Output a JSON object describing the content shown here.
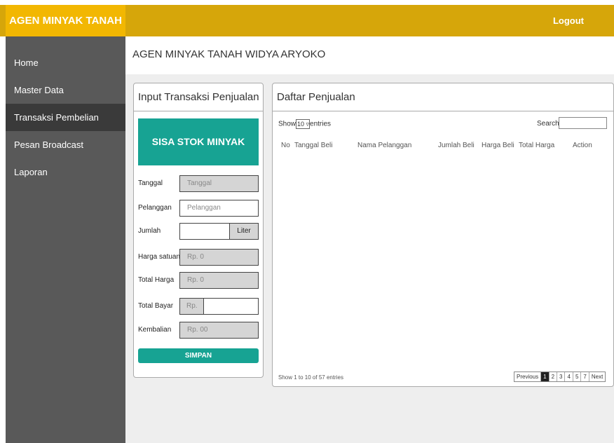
{
  "header": {
    "brand": "AGEN MINYAK TANAH",
    "logout_label": "Logout"
  },
  "sidebar": {
    "items": [
      {
        "label": "Home"
      },
      {
        "label": "Master Data"
      },
      {
        "label": "Transaksi Pembelian"
      },
      {
        "label": "Pesan Broadcast"
      },
      {
        "label": "Laporan"
      }
    ]
  },
  "main": {
    "page_title": "AGEN MINYAK TANAH WIDYA ARYOKO"
  },
  "form_panel": {
    "title": "Input Transaksi Penjualan",
    "stock_label": "SISA STOK MINYAK",
    "fields": {
      "tanggal": {
        "label": "Tanggal",
        "placeholder": "Tanggal"
      },
      "pelanggan": {
        "label": "Pelanggan",
        "placeholder": "Pelanggan"
      },
      "jumlah": {
        "label": "Jumlah",
        "unit": "Liter"
      },
      "harga_satuan": {
        "label": "Harga satuan",
        "value": "Rp. 0"
      },
      "total_harga": {
        "label": "Total Harga",
        "value": "Rp. 0"
      },
      "total_bayar": {
        "label": "Total Bayar",
        "prefix": "Rp."
      },
      "kembalian": {
        "label": "Kembalian",
        "value": "Rp. 00"
      }
    },
    "save_label": "SIMPAN"
  },
  "sales_panel": {
    "title": "Daftar Penjualan",
    "show_label": "Show",
    "entries_value": "10",
    "entries_label": "entries",
    "search_label": "Search",
    "columns": [
      "No",
      "Tanggal Beli",
      "Nama Pelanggan",
      "Jumlah Beli",
      "Harga Beli",
      "Total Harga",
      "Action"
    ],
    "info": "Show 1 to 10 of 57 entries",
    "pagination": {
      "previous": "Previous",
      "pages": [
        "1",
        "2",
        "3",
        "4",
        "5",
        "7"
      ],
      "next": "Next"
    }
  }
}
